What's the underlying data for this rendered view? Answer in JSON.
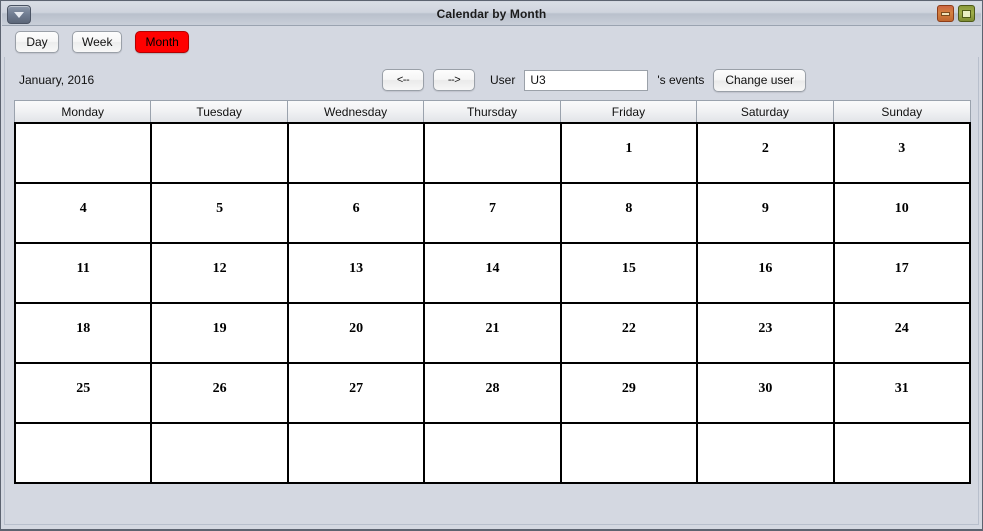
{
  "window": {
    "title": "Calendar by Month",
    "sysmenu_icon": "chevron-down-icon",
    "minimize_label": "",
    "maximize_label": ""
  },
  "toolbar": {
    "buttons": [
      {
        "label": "Day",
        "selected": false
      },
      {
        "label": "Week",
        "selected": false
      },
      {
        "label": "Month",
        "selected": true
      }
    ],
    "selected_color": "#ff0000"
  },
  "navigation": {
    "month_label": "January, 2016",
    "prev_label": "<--",
    "next_label": "-->",
    "user_label": "User",
    "user_value": "U3",
    "user_placeholder": "",
    "events_suffix": "'s events",
    "change_user_label": "Change user"
  },
  "calendar": {
    "day_headers": [
      "Monday",
      "Tuesday",
      "Wednesday",
      "Thursday",
      "Friday",
      "Saturday",
      "Sunday"
    ],
    "cells": [
      "",
      "",
      "",
      "",
      "1",
      "2",
      "3",
      "4",
      "5",
      "6",
      "7",
      "8",
      "9",
      "10",
      "11",
      "12",
      "13",
      "14",
      "15",
      "16",
      "17",
      "18",
      "19",
      "20",
      "21",
      "22",
      "23",
      "24",
      "25",
      "26",
      "27",
      "28",
      "29",
      "30",
      "31",
      "",
      "",
      "",
      "",
      "",
      "",
      ""
    ]
  }
}
